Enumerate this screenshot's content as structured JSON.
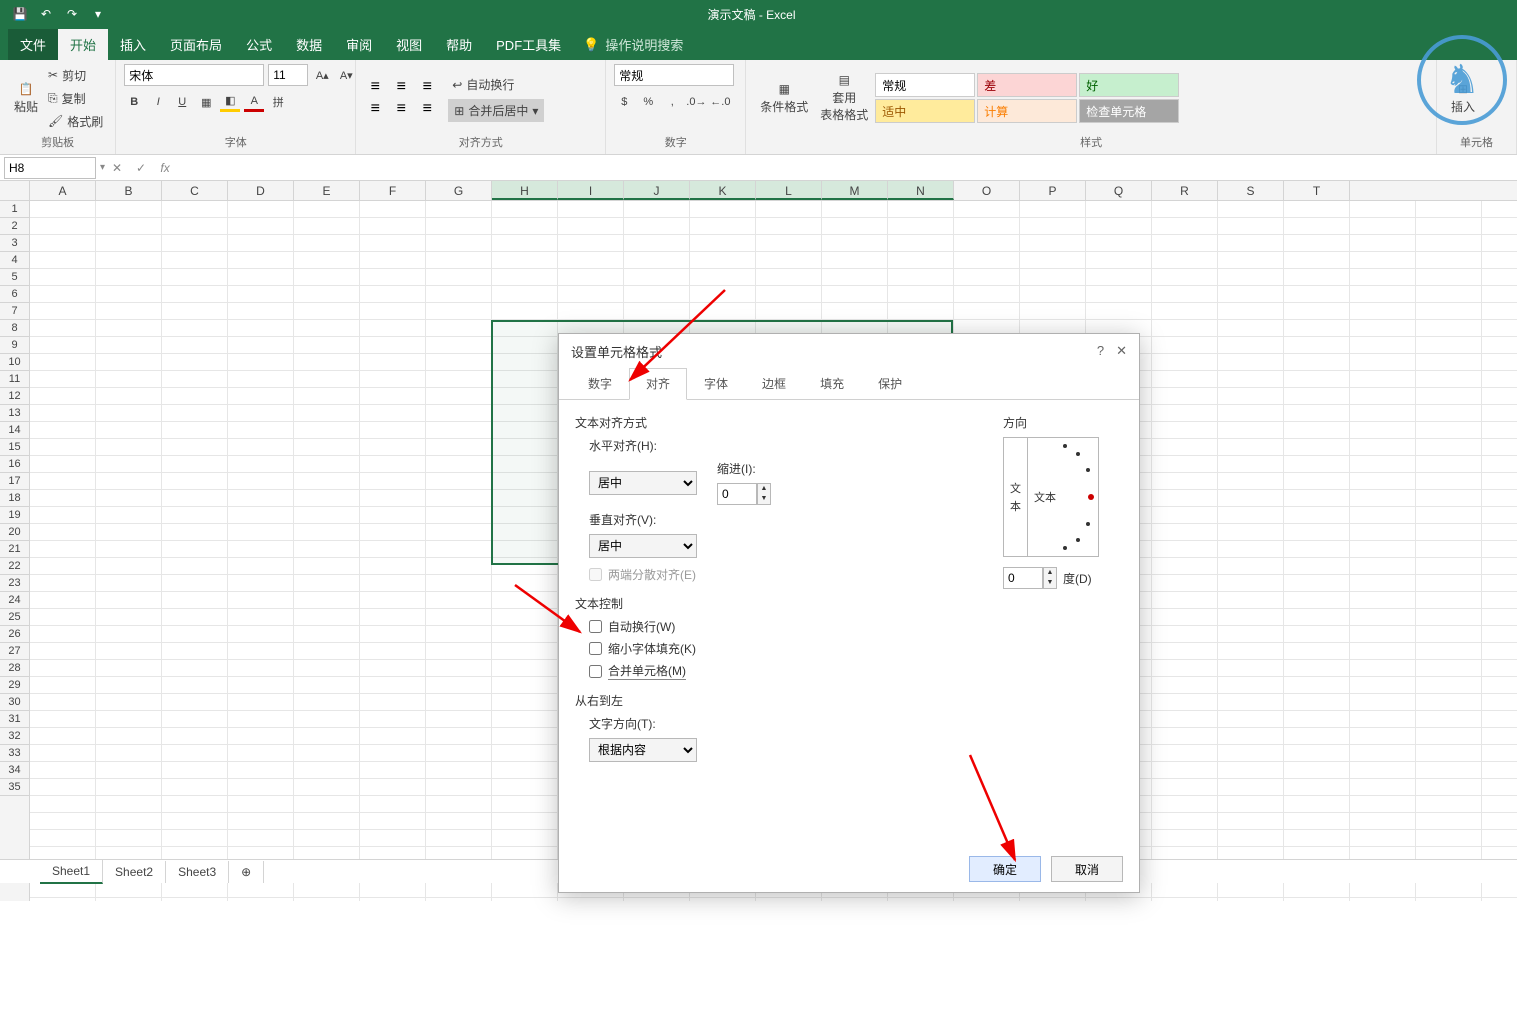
{
  "app_title": "演示文稿 - Excel",
  "tabs": {
    "file": "文件",
    "home": "开始",
    "insert": "插入",
    "layout": "页面布局",
    "formulas": "公式",
    "data": "数据",
    "review": "审阅",
    "view": "视图",
    "help": "帮助",
    "pdf": "PDF工具集",
    "tell": "操作说明搜索"
  },
  "ribbon": {
    "clipboard": {
      "paste": "粘贴",
      "cut": "剪切",
      "copy": "复制",
      "painter": "格式刷",
      "label": "剪贴板"
    },
    "font": {
      "name": "宋体",
      "size": "11",
      "label": "字体"
    },
    "align": {
      "wrap": "自动换行",
      "merge": "合并后居中",
      "label": "对齐方式"
    },
    "number": {
      "format": "常规",
      "label": "数字"
    },
    "styles": {
      "cond": "条件格式",
      "table": "套用\n表格格式",
      "s1": "常规",
      "s2": "差",
      "s3": "好",
      "s4": "适中",
      "s5": "计算",
      "s6": "检查单元格",
      "label": "样式"
    },
    "cells": {
      "insert": "插入",
      "label": "单元格"
    }
  },
  "name_box": "H8",
  "columns": [
    "A",
    "B",
    "C",
    "D",
    "E",
    "F",
    "G",
    "H",
    "I",
    "J",
    "K",
    "L",
    "M",
    "N",
    "O",
    "P",
    "Q",
    "R",
    "S",
    "T"
  ],
  "rows": [
    "1",
    "2",
    "3",
    "4",
    "5",
    "6",
    "7",
    "8",
    "9",
    "10",
    "11",
    "12",
    "13",
    "14",
    "15",
    "16",
    "17",
    "18",
    "19",
    "20",
    "21",
    "22",
    "23",
    "24",
    "25",
    "26",
    "27",
    "28",
    "29",
    "30",
    "31",
    "32",
    "33",
    "34",
    "35"
  ],
  "sheets": [
    "Sheet1",
    "Sheet2",
    "Sheet3"
  ],
  "dialog": {
    "title": "设置单元格格式",
    "tabs": {
      "number": "数字",
      "align": "对齐",
      "font": "字体",
      "border": "边框",
      "fill": "填充",
      "protect": "保护"
    },
    "sec_align": "文本对齐方式",
    "h_align_lbl": "水平对齐(H):",
    "h_align_val": "居中",
    "indent_lbl": "缩进(I):",
    "indent_val": "0",
    "v_align_lbl": "垂直对齐(V):",
    "v_align_val": "居中",
    "justify": "两端分散对齐(E)",
    "sec_ctrl": "文本控制",
    "wrap": "自动换行(W)",
    "shrink": "缩小字体填充(K)",
    "merge": "合并单元格(M)",
    "sec_rtl": "从右到左",
    "textdir_lbl": "文字方向(T):",
    "textdir_val": "根据内容",
    "orient_lbl": "方向",
    "orient_v1": "文",
    "orient_v2": "本",
    "orient_text": "文本",
    "degree_val": "0",
    "degree_lbl": "度(D)",
    "ok": "确定",
    "cancel": "取消"
  }
}
